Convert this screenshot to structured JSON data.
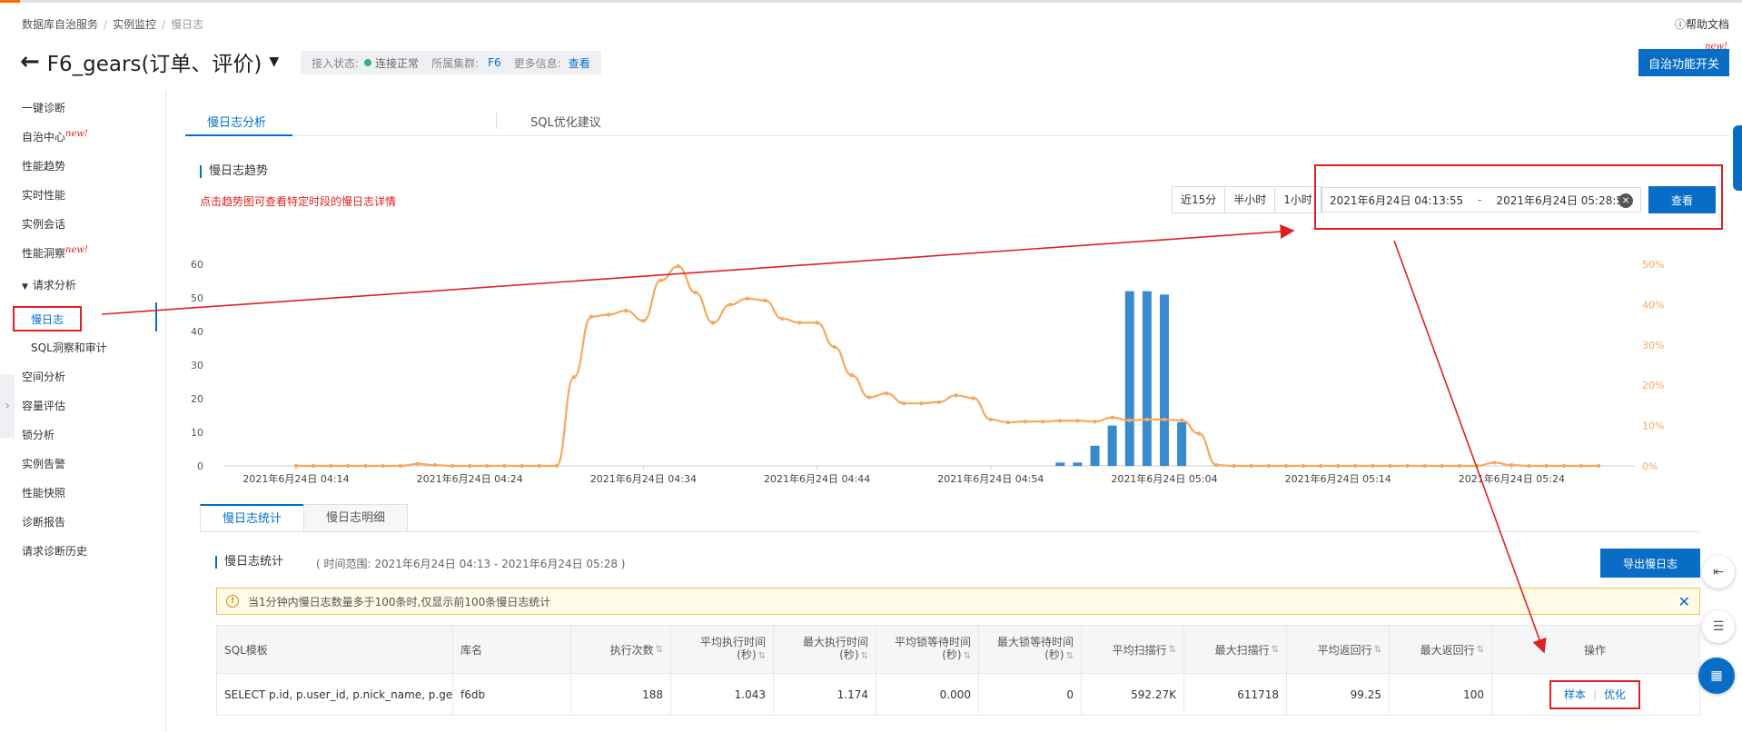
{
  "breadcrumb": {
    "items": [
      "数据库自治服务",
      "实例监控",
      "慢日志"
    ]
  },
  "help_doc": "帮助文档",
  "header": {
    "instance_title": "F6_gears(订单、评价)",
    "status_label": "接入状态:",
    "status_value": "连接正常",
    "cluster_label": "所属集群:",
    "cluster_value": "F6",
    "more_label": "更多信息:",
    "more_link": "查看",
    "autonomy_button": "自治功能开关",
    "new_badge": "new!"
  },
  "sidebar": {
    "items": [
      {
        "label": "一键诊断"
      },
      {
        "label": "自治中心",
        "badge": "new!"
      },
      {
        "label": "性能趋势"
      },
      {
        "label": "实时性能"
      },
      {
        "label": "实例会话"
      },
      {
        "label": "性能洞察",
        "badge": "new!"
      },
      {
        "label": "请求分析"
      },
      {
        "label": "慢日志"
      },
      {
        "label": "SQL洞察和审计"
      },
      {
        "label": "空间分析"
      },
      {
        "label": "容量评估"
      },
      {
        "label": "锁分析"
      },
      {
        "label": "实例告警"
      },
      {
        "label": "性能快照"
      },
      {
        "label": "诊断报告"
      },
      {
        "label": "请求诊断历史"
      }
    ]
  },
  "main_tabs": [
    {
      "label": "慢日志分析"
    },
    {
      "label": "SQL优化建议"
    }
  ],
  "trend": {
    "title": "慢日志趋势",
    "hint": "点击趋势图可查看特定时段的慢日志详情",
    "quick_ranges": [
      "近15分",
      "半小时",
      "1小时"
    ],
    "range_start": "2021年6月24日 04:13:55",
    "range_sep": "-",
    "range_end": "2021年6月24日 05:28:55",
    "query_button": "查看"
  },
  "chart_data": {
    "type": "bar",
    "x_tick_labels": [
      "2021年6月24日 04:14",
      "2021年6月24日 04:24",
      "2021年6月24日 04:34",
      "2021年6月24日 04:44",
      "2021年6月24日 04:54",
      "2021年6月24日 05:04",
      "2021年6月24日 05:14",
      "2021年6月24日 05:24"
    ],
    "y_left_ticks": [
      "0",
      "10",
      "20",
      "30",
      "40",
      "50",
      "60"
    ],
    "y_right_ticks": [
      "0%",
      "10%",
      "20%",
      "30%",
      "40%",
      "50%"
    ],
    "ylim_left": [
      0,
      60
    ],
    "ylim_right": [
      0,
      50
    ],
    "x_minutes_from_0414": {
      "start": 0,
      "end": 75
    },
    "colors": {
      "bars": "#3a8ad0",
      "line": "#f5a860",
      "axis_right": "#f5a860"
    },
    "series": [
      {
        "type": "bar",
        "axis": "left",
        "points": [
          [
            44,
            1
          ],
          [
            45,
            1
          ],
          [
            46,
            6
          ],
          [
            47,
            12
          ],
          [
            48,
            52
          ],
          [
            49,
            52
          ],
          [
            50,
            51
          ],
          [
            51,
            13
          ]
        ]
      },
      {
        "type": "line",
        "axis": "right",
        "points": [
          [
            0,
            0
          ],
          [
            1,
            0
          ],
          [
            2,
            0
          ],
          [
            3,
            0
          ],
          [
            4,
            0
          ],
          [
            5,
            0
          ],
          [
            6,
            0
          ],
          [
            7,
            0.5
          ],
          [
            8,
            0.2
          ],
          [
            9,
            0
          ],
          [
            10,
            0
          ],
          [
            11,
            0
          ],
          [
            12,
            0
          ],
          [
            13,
            0
          ],
          [
            14,
            0
          ],
          [
            15,
            0
          ],
          [
            16,
            22
          ],
          [
            17,
            37
          ],
          [
            18,
            37.5
          ],
          [
            19,
            38.5
          ],
          [
            20,
            36
          ],
          [
            21,
            46
          ],
          [
            22,
            49.5
          ],
          [
            23,
            43
          ],
          [
            24,
            35.5
          ],
          [
            25,
            40
          ],
          [
            26,
            41.5
          ],
          [
            27,
            41
          ],
          [
            28,
            36.5
          ],
          [
            29,
            35.5
          ],
          [
            30,
            35.5
          ],
          [
            31,
            29.5
          ],
          [
            32,
            22.5
          ],
          [
            33,
            17
          ],
          [
            34,
            18
          ],
          [
            35,
            15.5
          ],
          [
            36,
            15.5
          ],
          [
            37,
            15.8
          ],
          [
            38,
            17.5
          ],
          [
            39,
            16.8
          ],
          [
            40,
            11.5
          ],
          [
            41,
            10.8
          ],
          [
            42,
            11
          ],
          [
            43,
            11
          ],
          [
            44,
            11.2
          ],
          [
            45,
            11.2
          ],
          [
            46,
            11
          ],
          [
            47,
            12
          ],
          [
            48,
            11.3
          ],
          [
            49,
            11.5
          ],
          [
            50,
            11.5
          ],
          [
            51,
            11.3
          ],
          [
            52,
            8
          ],
          [
            53,
            0.2
          ],
          [
            54,
            0
          ],
          [
            55,
            0
          ],
          [
            56,
            0
          ],
          [
            57,
            0
          ],
          [
            58,
            0
          ],
          [
            59,
            0
          ],
          [
            60,
            0
          ],
          [
            61,
            0
          ],
          [
            62,
            0
          ],
          [
            63,
            0
          ],
          [
            64,
            0
          ],
          [
            65,
            0
          ],
          [
            66,
            0
          ],
          [
            67,
            0
          ],
          [
            68,
            0
          ],
          [
            69,
            0.8
          ],
          [
            70,
            0.2
          ],
          [
            71,
            0
          ],
          [
            72,
            0
          ],
          [
            73,
            0
          ],
          [
            74,
            0
          ],
          [
            75,
            0
          ]
        ]
      }
    ]
  },
  "stats_tabs": [
    {
      "label": "慢日志统计"
    },
    {
      "label": "慢日志明细"
    }
  ],
  "stats": {
    "title": "慢日志统计",
    "time_range": "( 时间范围: 2021年6月24日 04:13 - 2021年6月24日 05:28 )",
    "export_button": "导出慢日志",
    "notice": "当1分钟内慢日志数量多于100条时,仅显示前100条慢日志统计",
    "columns": {
      "sql": "SQL模板",
      "db": "库名",
      "exec_count": "执行次数",
      "avg_exec_l1": "平均执行时间",
      "avg_exec_l2": "(秒)",
      "max_exec_l1": "最大执行时间",
      "max_exec_l2": "(秒)",
      "avg_lock_l1": "平均锁等待时间",
      "avg_lock_l2": "(秒)",
      "max_lock_l1": "最大锁等待时间",
      "max_lock_l2": "(秒)",
      "avg_scan": "平均扫描行",
      "max_scan": "最大扫描行",
      "avg_ret": "平均返回行",
      "max_ret": "最大返回行",
      "ops": "操作"
    },
    "row": {
      "sql": "SELECT p.id, p.user_id, p.nick_name, p.ge...",
      "db": "f6db",
      "exec_count": "188",
      "avg_exec": "1.043",
      "max_exec": "1.174",
      "avg_lock": "0.000",
      "max_lock": "0",
      "avg_scan": "592.27K",
      "max_scan": "611718",
      "avg_ret": "99.25",
      "max_ret": "100",
      "op_sample": "样本",
      "op_optimize": "优化"
    }
  }
}
